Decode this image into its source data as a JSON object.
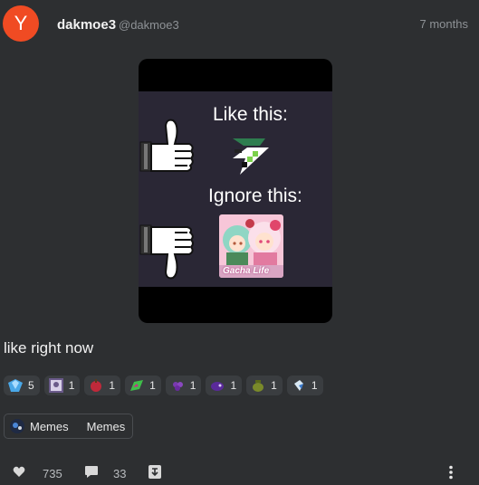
{
  "post": {
    "avatar_letter": "Y",
    "author_name": "dakmoe3",
    "author_handle": "@dakmoe3",
    "timestamp": "7 months",
    "caption": "like right now"
  },
  "meme": {
    "like_text": "Like this:",
    "ignore_text": "Ignore this:",
    "game_logo_text": "Gacha Life"
  },
  "reactions": [
    {
      "icon": "blue-crystal-icon",
      "count": "5"
    },
    {
      "icon": "framed-portrait-icon",
      "count": "1"
    },
    {
      "icon": "red-apple-icon",
      "count": "1"
    },
    {
      "icon": "green-leaf-icon",
      "count": "1"
    },
    {
      "icon": "purple-grapes-icon",
      "count": "1"
    },
    {
      "icon": "purple-blob-icon",
      "count": "1"
    },
    {
      "icon": "olive-jar-icon",
      "count": "1"
    },
    {
      "icon": "milk-bottle-icon",
      "count": "1"
    }
  ],
  "tags": {
    "label_1": "Memes",
    "label_2": "Memes"
  },
  "actions": {
    "like_count": "735",
    "comment_count": "33"
  },
  "colors": {
    "background": "#2d2f31",
    "avatar": "#f04b23",
    "muted_text": "#8e9296",
    "chip": "#3a3d40"
  }
}
